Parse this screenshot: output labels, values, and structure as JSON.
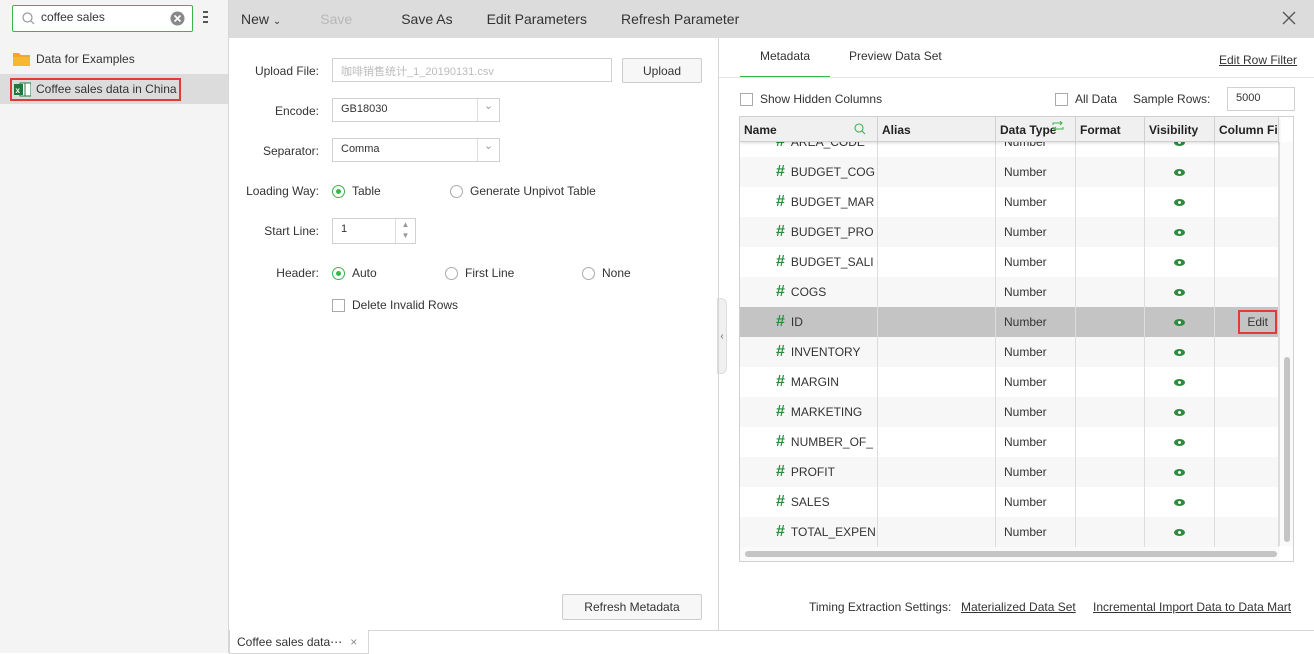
{
  "sidebar": {
    "search_value": "coffee sales",
    "items": [
      {
        "label": "Data for Examples",
        "icon": "folder-icon"
      },
      {
        "label": "Coffee sales data in China",
        "icon": "excel-icon"
      }
    ]
  },
  "toolbar": {
    "new": "New",
    "save": "Save",
    "save_as": "Save As",
    "edit_parameters": "Edit Parameters",
    "refresh_parameter": "Refresh Parameter"
  },
  "form": {
    "upload_file_label": "Upload File:",
    "upload_file_value": "咖啡销售统计_1_20190131.csv",
    "upload_button": "Upload",
    "encode_label": "Encode:",
    "encode_value": "GB18030",
    "separator_label": "Separator:",
    "separator_value": "Comma",
    "loading_way_label": "Loading Way:",
    "loading_options": [
      "Table",
      "Generate Unpivot Table"
    ],
    "start_line_label": "Start Line:",
    "start_line_value": "1",
    "header_label": "Header:",
    "header_options": [
      "Auto",
      "First Line",
      "None"
    ],
    "delete_invalid_rows": "Delete Invalid Rows",
    "refresh_metadata": "Refresh Metadata"
  },
  "right": {
    "tabs": [
      "Metadata",
      "Preview Data Set"
    ],
    "edit_row_filter": "Edit Row Filter",
    "show_hidden_columns": "Show Hidden Columns",
    "all_data": "All Data",
    "sample_rows_label": "Sample Rows:",
    "sample_rows_value": "5000",
    "columns": [
      "Name",
      "Alias",
      "Data Type",
      "Format",
      "Visibility",
      "Column Fi⋯"
    ],
    "rows": [
      {
        "name": "AREA_CODE",
        "type": "Number"
      },
      {
        "name": "BUDGET_COG",
        "type": "Number"
      },
      {
        "name": "BUDGET_MAR",
        "type": "Number"
      },
      {
        "name": "BUDGET_PRO",
        "type": "Number"
      },
      {
        "name": "BUDGET_SALI",
        "type": "Number"
      },
      {
        "name": "COGS",
        "type": "Number"
      },
      {
        "name": "ID",
        "type": "Number",
        "selected": true,
        "action": "Edit"
      },
      {
        "name": "INVENTORY",
        "type": "Number"
      },
      {
        "name": "MARGIN",
        "type": "Number"
      },
      {
        "name": "MARKETING",
        "type": "Number"
      },
      {
        "name": "NUMBER_OF_",
        "type": "Number"
      },
      {
        "name": "PROFIT",
        "type": "Number"
      },
      {
        "name": "SALES",
        "type": "Number"
      },
      {
        "name": "TOTAL_EXPEN",
        "type": "Number"
      }
    ],
    "timing_label": "Timing Extraction Settings:",
    "materialized": "Materialized Data Set",
    "incremental": "Incremental Import Data to Data Mart"
  },
  "bottom_tab": {
    "label": "Coffee sales data⋯"
  },
  "colors": {
    "accent": "#39b54a",
    "highlight": "#e53935",
    "icon_green": "#2e8b3e"
  }
}
